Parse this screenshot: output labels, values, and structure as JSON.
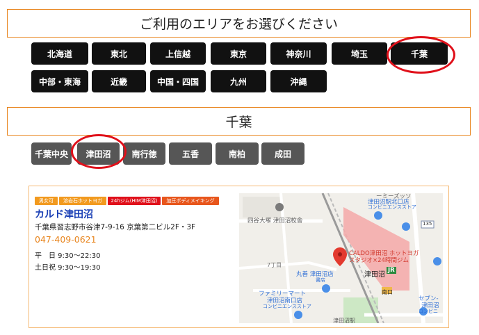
{
  "section_title": "ご利用のエリアをお選びください",
  "areas": [
    "北海道",
    "東北",
    "上信越",
    "東京",
    "神奈川",
    "埼玉",
    "千葉",
    "中部・東海",
    "近畿",
    "中国・四国",
    "九州",
    "沖縄"
  ],
  "selected_area_title": "千葉",
  "cities": [
    "千葉中央",
    "津田沼",
    "南行徳",
    "五香",
    "南柏",
    "成田"
  ],
  "colors": {
    "accent": "#e8841c",
    "button_dark": "#111111",
    "button_gray": "#565656",
    "highlight_ring": "#e0101a",
    "shop_name": "#1a3fb5"
  },
  "shop": {
    "tags": [
      "男女可",
      "溶岩石ホットヨガ",
      "24hジム(HIM津田沼)",
      "加圧ボディメイキング"
    ],
    "name": "カルド津田沼",
    "address": "千葉県習志野市谷津7-9-16 京葉第二ビル2F・3F",
    "phone": "047-409-0621",
    "hours_weekday": "平　日 9:30～22:30",
    "hours_weekend": "土日祝 9:30～19:30"
  },
  "map": {
    "labels": {
      "kitaguchi": "ーミーズッソ",
      "kitaguchi_store": "津田沼駅北口店",
      "conv1": "コンビニエンスストア",
      "school": "四谷大塚 津田沼校舎",
      "seven": "7丁目",
      "pin_l1": "CALDO津田沼 ホットヨガ",
      "pin_l2": "スタジオ×24時間ジム",
      "maruzen_1": "丸善 津田沼店",
      "maruzen_2": "書店",
      "station": "津田沼",
      "jr": "JR",
      "minamiguchi": "南口",
      "family_1": "ファミリーマート",
      "family_2": "津田沼南口店",
      "family_3": "コンビニエンスストア",
      "seven_r1": "セブン-",
      "seven_r2": "津田沼",
      "seven_r3": "コンビニ",
      "route": "135",
      "bottom": "津田沼駅"
    }
  }
}
